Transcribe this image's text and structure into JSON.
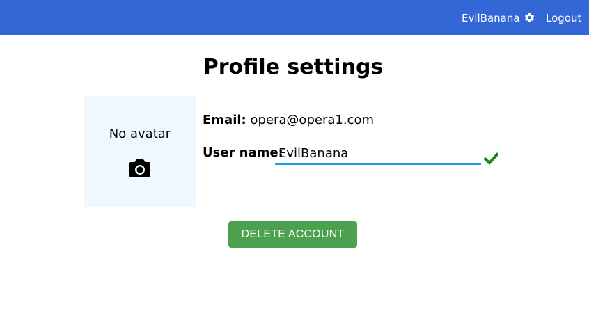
{
  "navbar": {
    "username": "EvilBanana",
    "settings_icon": "gear-icon",
    "logout_label": "Logout",
    "background_color": "#3367d6"
  },
  "page": {
    "title": "Profile settings"
  },
  "avatar": {
    "placeholder_text": "No avatar",
    "upload_icon": "camera-icon",
    "background_color": "#f0f8ff"
  },
  "profile": {
    "email_label": "Email:",
    "email_value": "opera@opera1.com",
    "username_label": "User name:",
    "username_value": "EvilBanana",
    "valid_icon": "checkmark-icon",
    "valid_color": "#108a10",
    "input_underline_color": "#1a9fe6"
  },
  "actions": {
    "delete_label": "DELETE ACCOUNT",
    "delete_color": "#4ca14e"
  }
}
